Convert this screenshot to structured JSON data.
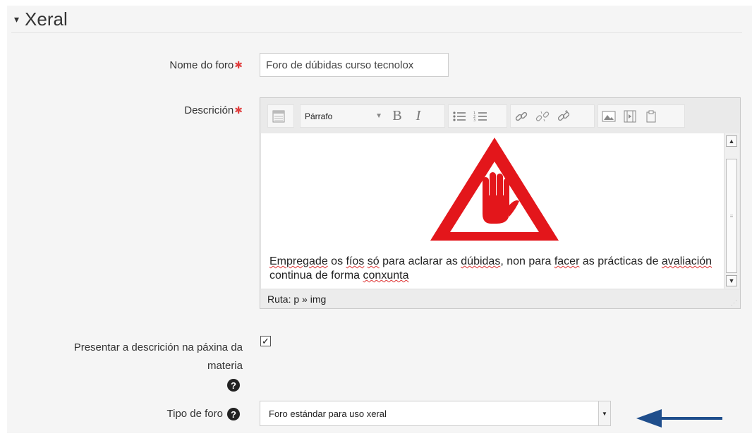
{
  "section": {
    "title": "Xeral",
    "caret": "▾"
  },
  "fields": {
    "forum_name": {
      "label": "Nome do foro",
      "required": "✱",
      "value": "Foro de dúbidas curso tecnolox"
    },
    "description": {
      "label": "Descrición",
      "required": "✱"
    },
    "show_description": {
      "label_line1": "Presentar a descrición na páxina da",
      "label_line2": "materia",
      "checked": true
    },
    "forum_type": {
      "label": "Tipo de foro",
      "value": "Foro estándar para uso xeral"
    }
  },
  "editor": {
    "format_select": "Párrafo",
    "toolbar_icons": [
      "collapse-icon",
      "bold-icon",
      "italic-icon",
      "unordered-list-icon",
      "ordered-list-icon",
      "link-icon",
      "unlink-icon",
      "anchor-icon",
      "image-icon",
      "media-icon",
      "paste-icon"
    ],
    "content": {
      "text_before": "",
      "words": [
        {
          "t": "Empregade",
          "spell": true
        },
        {
          "t": " os ",
          "spell": false
        },
        {
          "t": "fíos",
          "spell": true
        },
        {
          "t": " ",
          "spell": false
        },
        {
          "t": "só",
          "spell": true
        },
        {
          "t": " para aclarar as ",
          "spell": false
        },
        {
          "t": "dúbidas",
          "spell": true
        },
        {
          "t": ", non para ",
          "spell": false
        },
        {
          "t": "facer",
          "spell": true
        },
        {
          "t": " as prácticas de ",
          "spell": false
        },
        {
          "t": "avaliación",
          "spell": true
        },
        {
          "t": " continua de forma ",
          "spell": false
        },
        {
          "t": "conxunta",
          "spell": true
        }
      ]
    },
    "status_path": "Ruta: p » img"
  },
  "colors": {
    "required": "#e03c3c",
    "arrow": "#1f4e8c",
    "sign_red": "#e3161b"
  }
}
